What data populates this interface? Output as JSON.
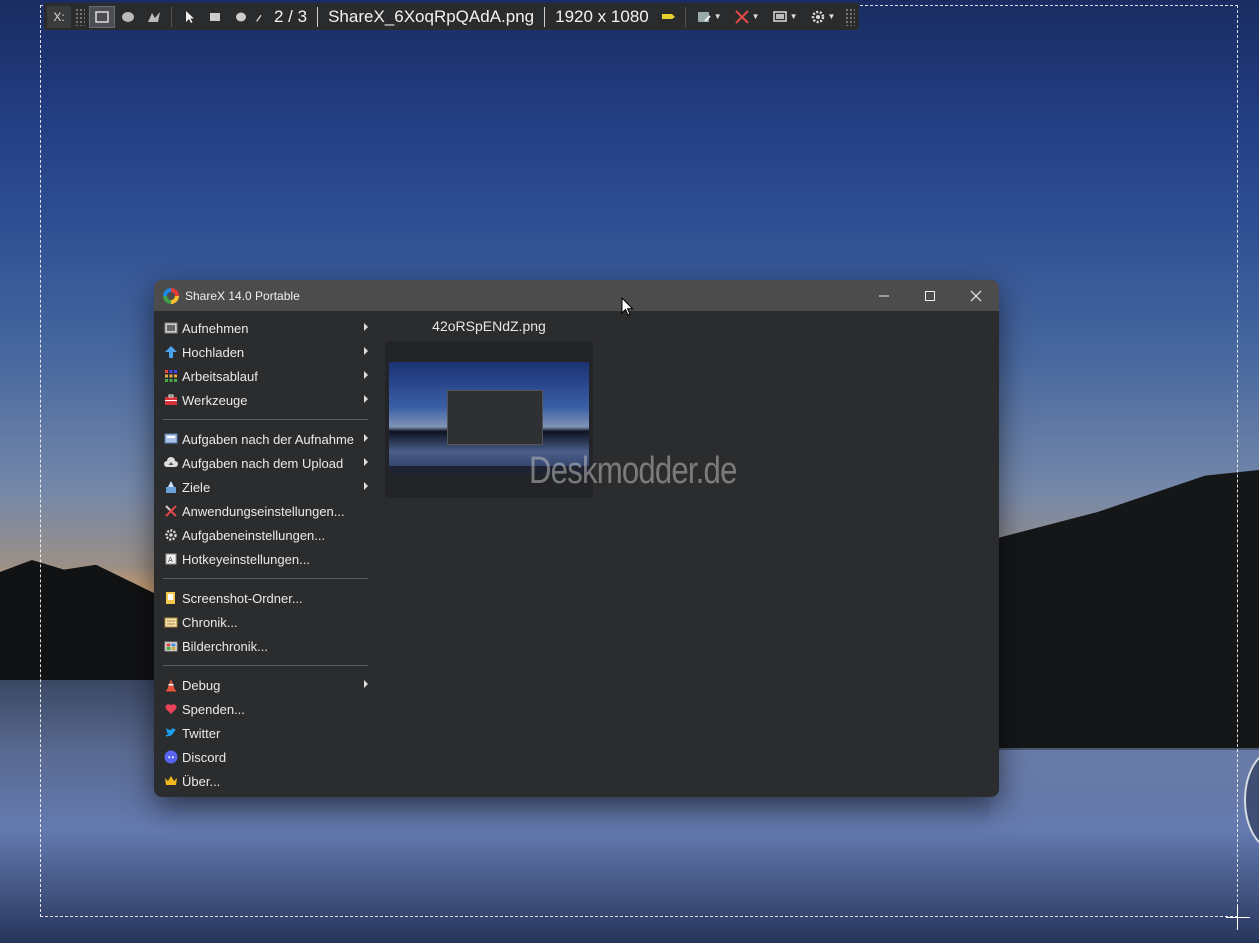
{
  "toolbar": {
    "x_label": "X:",
    "counter": "2 / 3",
    "filename": "ShareX_6XoqRpQAdA.png",
    "resolution": "1920 x 1080"
  },
  "window": {
    "title": "ShareX 14.0 Portable",
    "minimize_glyph": "—",
    "close_glyph": "✕"
  },
  "menu": {
    "group1": [
      {
        "label": "Aufnehmen",
        "icon": "capture-icon",
        "submenu": true
      },
      {
        "label": "Hochladen",
        "icon": "upload-arrow-icon",
        "submenu": true
      },
      {
        "label": "Arbeitsablauf",
        "icon": "workflow-dots-icon",
        "submenu": true
      },
      {
        "label": "Werkzeuge",
        "icon": "toolbox-icon",
        "submenu": true
      }
    ],
    "group2": [
      {
        "label": "Aufgaben nach der Aufnahme",
        "icon": "after-capture-icon",
        "submenu": true
      },
      {
        "label": "Aufgaben nach dem Upload",
        "icon": "cloud-icon",
        "submenu": true
      },
      {
        "label": "Ziele",
        "icon": "destinations-icon",
        "submenu": true
      },
      {
        "label": "Anwendungseinstellungen...",
        "icon": "tools-icon",
        "submenu": false
      },
      {
        "label": "Aufgabeneinstellungen...",
        "icon": "gear-icon",
        "submenu": false
      },
      {
        "label": "Hotkeyeinstellungen...",
        "icon": "keyboard-icon",
        "submenu": false
      }
    ],
    "group3": [
      {
        "label": "Screenshot-Ordner...",
        "icon": "folder-icon",
        "submenu": false
      },
      {
        "label": "Chronik...",
        "icon": "history-icon",
        "submenu": false
      },
      {
        "label": "Bilderchronik...",
        "icon": "image-history-icon",
        "submenu": false
      }
    ],
    "group4": [
      {
        "label": "Debug",
        "icon": "debug-cone-icon",
        "submenu": true
      },
      {
        "label": "Spenden...",
        "icon": "heart-icon",
        "submenu": false
      },
      {
        "label": "Twitter",
        "icon": "twitter-icon",
        "submenu": false
      },
      {
        "label": "Discord",
        "icon": "discord-icon",
        "submenu": false
      },
      {
        "label": "Über...",
        "icon": "crown-icon",
        "submenu": false
      }
    ]
  },
  "thumbnail": {
    "filename": "42oRSpENdZ.png"
  },
  "watermark": "Deskmodder.de"
}
